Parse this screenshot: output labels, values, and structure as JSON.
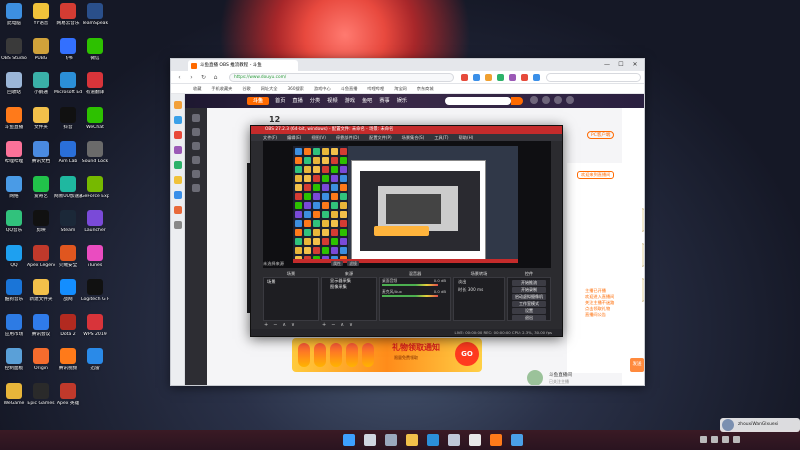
{
  "desktop": {
    "icons": [
      {
        "label": "此电脑",
        "color": "#3d8fe0"
      },
      {
        "label": "OBS Studio",
        "color": "#3a3a3a"
      },
      {
        "label": "回收站",
        "color": "#9bb6d8"
      },
      {
        "label": "斗鱼直播",
        "color": "#ff7a1a"
      },
      {
        "label": "哔哩哔哩",
        "color": "#fb7299"
      },
      {
        "label": "网络",
        "color": "#4a9be6"
      },
      {
        "label": "QQ音乐",
        "color": "#31c27c"
      },
      {
        "label": "QQ",
        "color": "#1ea0f0"
      },
      {
        "label": "酷狗音乐",
        "color": "#1a75d8"
      },
      {
        "label": "应用市场",
        "color": "#2d7be4"
      },
      {
        "label": "控制面板",
        "color": "#5aa0d8"
      },
      {
        "label": "WeGame",
        "color": "#e8b63a"
      },
      {
        "label": "YY语音",
        "color": "#f0c23a"
      },
      {
        "label": "PUBG",
        "color": "#d0a23a"
      },
      {
        "label": "小鹅通",
        "color": "#3ab0a8"
      },
      {
        "label": "文件夹",
        "color": "#f2c04a"
      },
      {
        "label": "腾讯文档",
        "color": "#4a8ae0"
      },
      {
        "label": "爱奇艺",
        "color": "#21c24a"
      },
      {
        "label": "剪映",
        "color": "#111111"
      },
      {
        "label": "Apex Legends",
        "color": "#c0392b"
      },
      {
        "label": "新建文件夹",
        "color": "#f2c04a"
      },
      {
        "label": "腾讯会议",
        "color": "#2f7bea"
      },
      {
        "label": "Origin",
        "color": "#f56c2d"
      },
      {
        "label": "Epic Games",
        "color": "#2a2a2a"
      },
      {
        "label": "网易云音乐",
        "color": "#d43c33"
      },
      {
        "label": "飞书",
        "color": "#3370ff"
      },
      {
        "label": "Microsoft Edge",
        "color": "#2b8fd8"
      },
      {
        "label": "抖音",
        "color": "#111111"
      },
      {
        "label": "Aim Lab",
        "color": "#2a6fd8"
      },
      {
        "label": "网易UU加速器",
        "color": "#1fb8a0"
      },
      {
        "label": "Steam",
        "color": "#1b2838"
      },
      {
        "label": "火绒安全",
        "color": "#e0561f"
      },
      {
        "label": "战网",
        "color": "#148eff"
      },
      {
        "label": "Dota 2",
        "color": "#b22a20"
      },
      {
        "label": "腾讯视频",
        "color": "#ff7a1a"
      },
      {
        "label": "Apex 英雄",
        "color": "#c0392b"
      },
      {
        "label": "TeamSpeak",
        "color": "#2a4f8a"
      },
      {
        "label": "微信",
        "color": "#2dc100"
      },
      {
        "label": "有道翻译",
        "color": "#d8343a"
      },
      {
        "label": "WeChat",
        "color": "#2dc100"
      },
      {
        "label": "Sound Lock",
        "color": "#6a6a6a"
      },
      {
        "label": "GeForce Experience",
        "color": "#76b900"
      },
      {
        "label": "Launcher",
        "color": "#7a4ad8"
      },
      {
        "label": "iTunes",
        "color": "#ea4cc0"
      },
      {
        "label": "Logitech G HUB",
        "color": "#111111"
      },
      {
        "label": "WPS 2019",
        "color": "#d8343a"
      },
      {
        "label": "迅雷",
        "color": "#2a8ae8"
      }
    ]
  },
  "browser": {
    "tab_title": "斗鱼直播 OBS 推流教程 - 斗鱼",
    "window_controls": {
      "minimize": "—",
      "maximize": "☐",
      "close": "✕"
    },
    "nav": {
      "back": "‹",
      "forward": "›",
      "refresh": "↻",
      "home": "⌂"
    },
    "url": "https://www.douyu.com/",
    "bookmarks": [
      "收藏",
      "手机收藏夹",
      "谷歌",
      "网址大全",
      "360搜索",
      "游戏中心",
      "斗鱼直播",
      "哔哩哔哩",
      "淘宝网",
      "京东商城"
    ],
    "douyu": {
      "logo": "斗鱼",
      "nav": [
        "首页",
        "直播",
        "分类",
        "视频",
        "游戏",
        "鱼吧",
        "赛事",
        "娱乐"
      ],
      "right_labels": [
        "历史",
        "关注",
        "客户端"
      ],
      "room_number": "12",
      "pc_download": "PC客户端",
      "gift_banner_title": "礼物领取通知",
      "gift_banner_sub": "限量免费领取",
      "gift_banner_go": "GO",
      "chat_tag": "欢迎来到直播间",
      "chat_lines": [
        "主播已开播",
        "欢迎进入直播间",
        "关注主播不迷路",
        "点击领取礼物",
        "直播间公告"
      ],
      "send_label": "发送",
      "streamer_name": "斗鱼直播间",
      "streamer_desc": "已关注主播"
    }
  },
  "obs": {
    "title": "OBS 27.2.3 (64-bit, windows) - 配置文件: 未命名 - 场景: 未命名",
    "menu": [
      "文件(F)",
      "编辑(E)",
      "视图(V)",
      "停靠部件(D)",
      "配置文件(P)",
      "场景集合(S)",
      "工具(T)",
      "帮助(H)"
    ],
    "preview_scene_label": "未选择来源",
    "preview_buttons": [
      "属性",
      "滤镜"
    ],
    "docks": {
      "scenes_title": "场景",
      "sources_title": "来源",
      "mixer_title": "混音器",
      "transitions_title": "场景转场",
      "controls_title": "控件"
    },
    "scenes": [
      "场景"
    ],
    "sources": [
      "显示器采集",
      "图像采集"
    ],
    "mixer": [
      {
        "name": "桌面音频",
        "level": "0.0 dB"
      },
      {
        "name": "麦克风/Aux",
        "level": "0.0 dB"
      }
    ],
    "transitions": {
      "type": "淡出",
      "duration_label": "时长",
      "duration": "300 ms"
    },
    "controls": [
      "开始推流",
      "开始录制",
      "启动虚拟摄像机",
      "工作室模式",
      "设置",
      "退出"
    ],
    "dock_footer": [
      "+",
      "−",
      "∧",
      "∨"
    ],
    "status": "LIVE: 00:00:00   REC: 00:00:00   CPU: 2.3%, 30.00 fps"
  },
  "taskbar": {
    "apps": [
      {
        "name": "start",
        "color": "#3da0ff"
      },
      {
        "name": "search",
        "color": "#cfd6e0"
      },
      {
        "name": "task-view",
        "color": "#9aa8bd"
      },
      {
        "name": "file-explorer",
        "color": "#f2c04a"
      },
      {
        "name": "edge",
        "color": "#2b8fd8"
      },
      {
        "name": "steam",
        "color": "#bfc8d8"
      },
      {
        "name": "obs",
        "color": "#e8e8e8"
      },
      {
        "name": "douyu",
        "color": "#ff7a1a"
      },
      {
        "name": "browser",
        "color": "#4aa0e8"
      }
    ],
    "user_name": "zhouxiWanGlxuexi",
    "clock_time": "",
    "clock_date": ""
  }
}
